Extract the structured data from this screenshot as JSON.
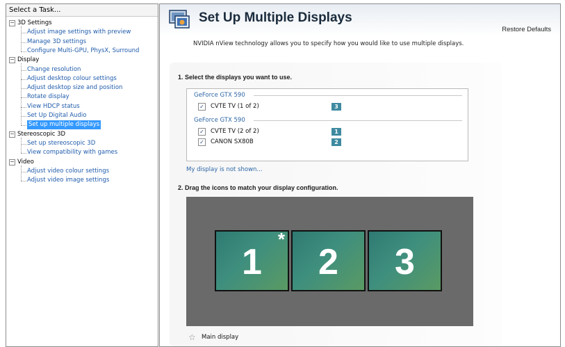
{
  "task_panel": {
    "header": "Select a Task...",
    "tree": [
      {
        "label": "3D Settings",
        "kind": "category",
        "expander": "−"
      },
      {
        "label": "Adjust image settings with preview",
        "kind": "leaf"
      },
      {
        "label": "Manage 3D settings",
        "kind": "leaf"
      },
      {
        "label": "Configure Multi-GPU, PhysX, Surround",
        "kind": "leaf"
      },
      {
        "label": "Display",
        "kind": "category",
        "expander": "−"
      },
      {
        "label": "Change resolution",
        "kind": "leaf"
      },
      {
        "label": "Adjust desktop colour settings",
        "kind": "leaf"
      },
      {
        "label": "Adjust desktop size and position",
        "kind": "leaf"
      },
      {
        "label": "Rotate display",
        "kind": "leaf"
      },
      {
        "label": "View HDCP status",
        "kind": "leaf"
      },
      {
        "label": "Set Up Digital Audio",
        "kind": "leaf"
      },
      {
        "label": "Set up multiple displays",
        "kind": "leaf",
        "selected": true
      },
      {
        "label": "Stereoscopic 3D",
        "kind": "category",
        "expander": "−"
      },
      {
        "label": "Set up stereoscopic 3D",
        "kind": "leaf"
      },
      {
        "label": "View compatibility with games",
        "kind": "leaf"
      },
      {
        "label": "Video",
        "kind": "category",
        "expander": "−"
      },
      {
        "label": "Adjust video colour settings",
        "kind": "leaf"
      },
      {
        "label": "Adjust video image settings",
        "kind": "leaf"
      }
    ]
  },
  "content": {
    "title": "Set Up Multiple Displays",
    "restore_defaults": "Restore Defaults",
    "description": "NVIDIA nView technology allows you to specify how you would like to use multiple displays.",
    "section1_title": "1. Select the displays you want to use.",
    "gpus": [
      {
        "name": "GeForce GTX 590",
        "displays": [
          {
            "name": "CVTE TV (1 of 2)",
            "checked": true,
            "number": "3"
          }
        ]
      },
      {
        "name": "GeForce GTX 590",
        "displays": [
          {
            "name": "CVTE TV (2 of 2)",
            "checked": true,
            "number": "1"
          },
          {
            "name": "CANON SX80B",
            "checked": true,
            "number": "2"
          }
        ]
      }
    ],
    "not_shown_link": "My display is not shown...",
    "section2_title": "2. Drag the icons to match your display configuration.",
    "monitors": [
      {
        "number": "1",
        "main": true
      },
      {
        "number": "2",
        "main": false
      },
      {
        "number": "3",
        "main": false
      }
    ],
    "main_display_label": "Main display",
    "main_star": "☆"
  },
  "colors": {
    "selected_bg": "#3399ff",
    "link": "#2d66a6",
    "badge": "#3e8aa0",
    "arrangement_bg": "#6a6a6a"
  }
}
